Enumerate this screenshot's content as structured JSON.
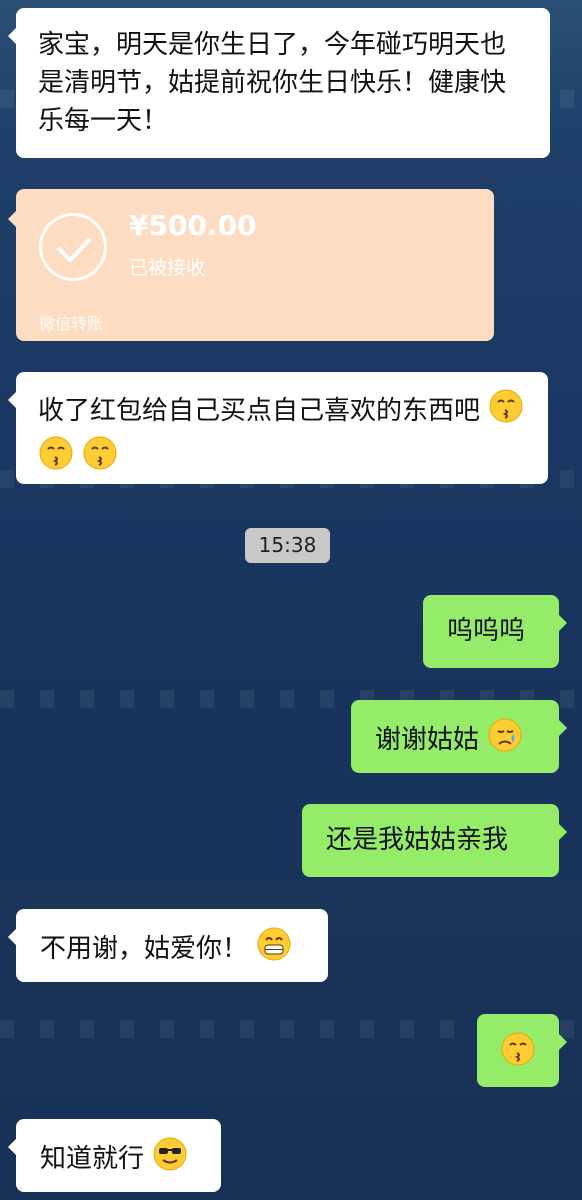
{
  "messages": [
    {
      "id": "m1",
      "side": "left",
      "text": "家宝，明天是你生日了，今年碰巧明天也是清明节，姑提前祝你生日快乐！健康快乐每一天！"
    },
    {
      "id": "transfer",
      "side": "left",
      "amount": "¥500.00",
      "status": "已被接收",
      "footer": "微信转账"
    },
    {
      "id": "m2",
      "side": "left",
      "text": "收了红包给自己买点自己喜欢的东西吧"
    },
    {
      "id": "timestamp",
      "text": "15:38"
    },
    {
      "id": "m3",
      "side": "right",
      "text": "呜呜呜"
    },
    {
      "id": "m4",
      "side": "right",
      "text": "谢谢姑姑"
    },
    {
      "id": "m5",
      "side": "right",
      "text": "还是我姑姑亲我"
    },
    {
      "id": "m6",
      "side": "left",
      "text": "不用谢，姑爱你！"
    },
    {
      "id": "m7",
      "side": "right",
      "text": ""
    },
    {
      "id": "m8",
      "side": "left",
      "text": "知道就行"
    }
  ],
  "colors": {
    "left_bubble": "#ffffff",
    "right_bubble": "#95ec69",
    "transfer_bubble": "#fddcc2",
    "timestamp_bg": "#c8c8c8"
  },
  "icons": {
    "transfer": "check-circle-icon",
    "kiss": "kissing-face-icon",
    "cry": "crying-face-icon",
    "grin": "grinning-face-icon",
    "cool": "sunglasses-face-icon"
  }
}
